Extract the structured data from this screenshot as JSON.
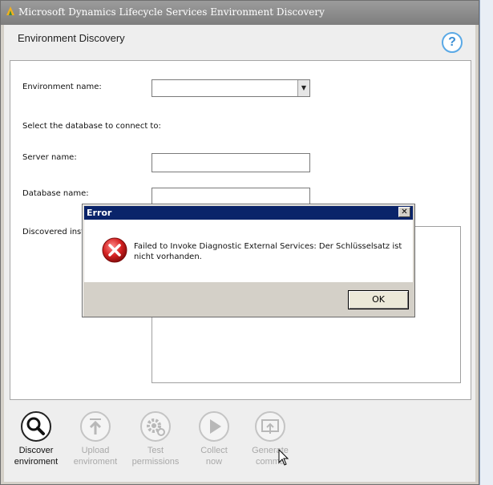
{
  "window": {
    "title": "Microsoft Dynamics Lifecycle Services Environment Discovery"
  },
  "header": {
    "title": "Environment Discovery",
    "help_icon": "question-icon",
    "help_glyph": "?"
  },
  "form": {
    "environment_name_label": "Environment name:",
    "environment_name_value": "",
    "database_prompt": "Select the database to connect to:",
    "server_name_label": "Server name:",
    "server_name_value": "",
    "database_name_label": "Database name:",
    "database_name_value": "",
    "discovered_instances_label": "Discovered inst"
  },
  "toolbar": {
    "items": [
      {
        "line1": "Discover",
        "line2": "enviroment",
        "icon": "magnifier-icon",
        "enabled": true
      },
      {
        "line1": "Upload",
        "line2": "enviroment",
        "icon": "upload-icon",
        "enabled": false
      },
      {
        "line1": "Test",
        "line2": "permissions",
        "icon": "gear-icon",
        "enabled": false
      },
      {
        "line1": "Collect",
        "line2": "now",
        "icon": "play-icon",
        "enabled": false
      },
      {
        "line1": "Generate",
        "line2": "comma",
        "icon": "generate-icon",
        "enabled": false
      }
    ]
  },
  "error_dialog": {
    "title": "Error",
    "close_glyph": "✕",
    "message": "Failed to Invoke Diagnostic External Services: Der Schlüsselsatz ist nicht vorhanden.",
    "ok_label": "OK",
    "icon": "error-icon"
  },
  "colors": {
    "error_title_bg": "#0a246a",
    "error_icon_red": "#d42121",
    "help_blue": "#3c8fd4"
  }
}
